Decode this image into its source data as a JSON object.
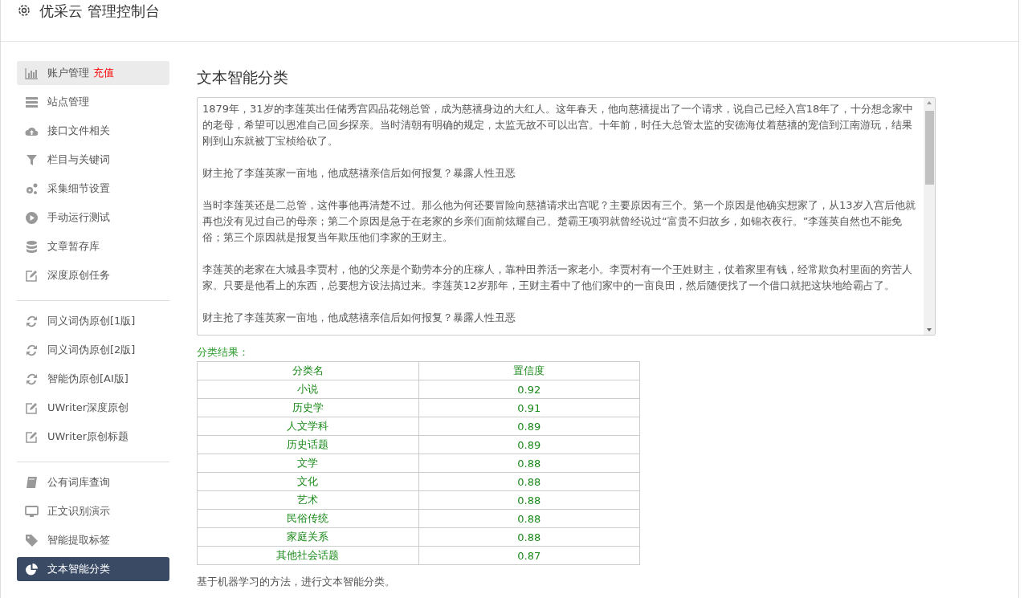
{
  "header": {
    "title": "优采云 管理控制台"
  },
  "sidebar": {
    "groups": [
      {
        "items": [
          {
            "label": "账户管理",
            "badge": "充值",
            "selected": false,
            "hovered": true
          },
          {
            "label": "站点管理",
            "selected": false,
            "hovered": false
          },
          {
            "label": "接口文件相关",
            "selected": false,
            "hovered": false
          },
          {
            "label": "栏目与关键词",
            "selected": false,
            "hovered": false
          },
          {
            "label": "采集细节设置",
            "selected": false,
            "hovered": false
          },
          {
            "label": "手动运行测试",
            "selected": false,
            "hovered": false
          },
          {
            "label": "文章暂存库",
            "selected": false,
            "hovered": false
          },
          {
            "label": "深度原创任务",
            "selected": false,
            "hovered": false
          }
        ]
      },
      {
        "items": [
          {
            "label": "同义词伪原创[1版]",
            "selected": false,
            "hovered": false
          },
          {
            "label": "同义词伪原创[2版]",
            "selected": false,
            "hovered": false
          },
          {
            "label": "智能伪原创[AI版]",
            "selected": false,
            "hovered": false
          },
          {
            "label": "UWriter深度原创",
            "selected": false,
            "hovered": false
          },
          {
            "label": "UWriter原创标题",
            "selected": false,
            "hovered": false
          }
        ]
      },
      {
        "items": [
          {
            "label": "公有词库查询",
            "selected": false,
            "hovered": false
          },
          {
            "label": "正文识别演示",
            "selected": false,
            "hovered": false
          },
          {
            "label": "智能提取标签",
            "selected": false,
            "hovered": false
          },
          {
            "label": "文本智能分类",
            "selected": true,
            "hovered": false
          }
        ]
      }
    ]
  },
  "main": {
    "heading": "文本智能分类",
    "text_input": {
      "paragraphs": [
        "1879年，31岁的李莲英出任储秀宫四品花翎总管，成为慈禧身边的大红人。这年春天，他向慈禧提出了一个请求，说自己已经入宫18年了，十分想念家中的老母，希望可以恩准自己回乡探亲。当时清朝有明确的规定，太监无故不可以出宫。十年前，时任大总管太监的安德海仗着慈禧的宠信到江南游玩，结果刚到山东就被丁宝桢给砍了。",
        "财主抢了李莲英家一亩地，他成慈禧亲信后如何报复？暴露人性丑恶",
        "当时李莲英还是二总管，这件事他再清楚不过。那么他为何还要冒险向慈禧请求出宫呢？主要原因有三个。第一个原因是他确实想家了，从13岁入宫后他就再也没有见过自己的母亲；第二个原因是急于在老家的乡亲们面前炫耀自己。楚霸王项羽就曾经说过“富贵不归故乡，如锦衣夜行。”李莲英自然也不能免俗；第三个原因就是报复当年欺压他们李家的王财主。",
        "李莲英的老家在大城县李贾村，他的父亲是个勤劳本分的庄稼人，靠种田养活一家老小。李贾村有一个王姓财主，仗着家里有钱，经常欺负村里面的穷苦人家。只要是他看上的东西，总要想方设法搞过来。李莲英12岁那年，王财主看中了他们家中的一亩良田，然后随便找了一个借口就把这块地给霸占了。",
        "财主抢了李莲英家一亩地，他成慈禧亲信后如何报复？暴露人性丑恶"
      ]
    },
    "result_label": "分类结果：",
    "table": {
      "columns": [
        "分类名",
        "置信度"
      ],
      "rows": [
        [
          "小说",
          "0.92"
        ],
        [
          "历史学",
          "0.91"
        ],
        [
          "人文学科",
          "0.89"
        ],
        [
          "历史话题",
          "0.89"
        ],
        [
          "文学",
          "0.88"
        ],
        [
          "文化",
          "0.88"
        ],
        [
          "艺术",
          "0.88"
        ],
        [
          "民俗传统",
          "0.88"
        ],
        [
          "家庭关系",
          "0.88"
        ],
        [
          "其他社会话题",
          "0.87"
        ]
      ]
    },
    "note": "基于机器学习的方法，进行文本智能分类。"
  }
}
